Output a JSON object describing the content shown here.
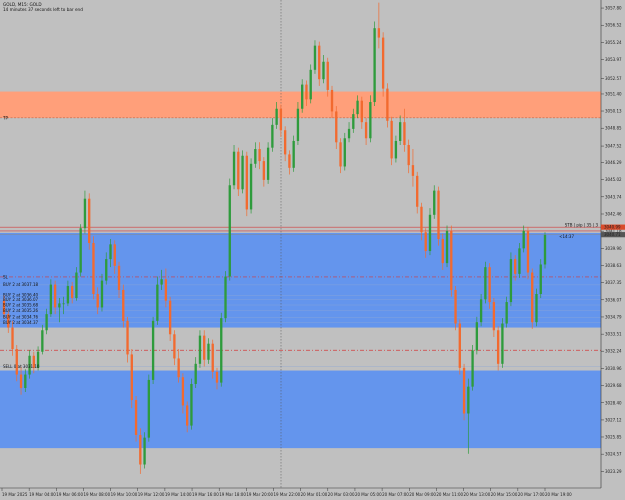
{
  "window": {
    "symbol_line": "GOLD, M15: GOLD",
    "countdown_line": "14 minutes 37 seconds left to bar end"
  },
  "colors": {
    "background": "#c0c0c0",
    "bull_candle": "#2e9b3c",
    "bear_candle": "#f26a2f",
    "blue_zone": "#6495ed",
    "salmon_zone": "#ff9f7a",
    "red_dash": "#d23a3a",
    "price_tag": "#d94b2b"
  },
  "zones": [
    {
      "name": "salmon",
      "from": 3051.58,
      "to": 3049.62
    },
    {
      "name": "blue-upper",
      "from": 3041.05,
      "to": 3034.0
    },
    {
      "name": "blue-lower",
      "from": 3030.8,
      "to": 3025.02
    }
  ],
  "levels": {
    "tp": {
      "label": "TP",
      "price": 3049.62
    },
    "red_line_1": 3041.48,
    "red_line_2": 3041.2,
    "dash_1": 3037.77,
    "dash_2": 3032.31,
    "current_price": 3040.92,
    "stop_tag": "3040.99",
    "bid_tag": "3040.71"
  },
  "order_labels": [
    "BUY 2 at 3037.18",
    "BUY 2 at 3036.40",
    "BUY 2 at 3036.07",
    "BUY 2 at 3035.68",
    "BUY 2 at 3035.26",
    "BUY 2 at 3034.76",
    "BUY 2 at 3034.37"
  ],
  "sl_label": "SL",
  "sell_label": "SELL 0 at 3031.10",
  "stop_line_label": "STB | pip | 35 | 3",
  "countdown_tag": "<14:37",
  "price_axis": [
    "3057.80",
    "3056.52",
    "3055.24",
    "3053.97",
    "3052.57",
    "3051.40",
    "3050.13",
    "3048.85",
    "3047.52",
    "3046.29",
    "3045.02",
    "3043.74",
    "3042.46",
    "3041.18",
    "3039.90",
    "3038.63",
    "3037.35",
    "3036.07",
    "3034.79",
    "3033.51",
    "3032.24",
    "3030.96",
    "3029.68",
    "3028.40",
    "3027.12",
    "3025.85",
    "3024.57",
    "3023.29"
  ],
  "time_axis": [
    "19 Mar 2025",
    "19 Mar 04:00",
    "19 Mar 06:00",
    "19 Mar 08:00",
    "19 Mar 10:00",
    "19 Mar 12:00",
    "19 Mar 14:00",
    "19 Mar 16:00",
    "19 Mar 18:00",
    "19 Mar 20:00",
    "19 Mar 22:00",
    "20 Mar 01:00",
    "20 Mar 03:00",
    "20 Mar 05:00",
    "20 Mar 07:00",
    "20 Mar 09:00",
    "20 Mar 11:00",
    "20 Mar 13:00",
    "20 Mar 15:00",
    "20 Mar 17:00",
    "20 Mar 19:00"
  ],
  "price_range": [
    3022.05,
    3058.4
  ],
  "chart_data": {
    "type": "candlestick",
    "timeframe": "M15",
    "ohlc": [
      [
        3036.0,
        3036.4,
        3034.7,
        3035.0
      ],
      [
        3035.0,
        3035.3,
        3033.6,
        3034.0
      ],
      [
        3034.0,
        3034.5,
        3031.9,
        3032.4
      ],
      [
        3032.4,
        3032.7,
        3030.0,
        3030.5
      ],
      [
        3030.5,
        3031.1,
        3029.0,
        3029.5
      ],
      [
        3029.5,
        3030.9,
        3029.2,
        3030.5
      ],
      [
        3030.5,
        3032.3,
        3030.2,
        3031.9
      ],
      [
        3031.9,
        3032.2,
        3030.6,
        3031.0
      ],
      [
        3031.0,
        3032.6,
        3030.8,
        3032.2
      ],
      [
        3032.2,
        3034.2,
        3032.0,
        3033.8
      ],
      [
        3033.8,
        3035.4,
        3033.5,
        3035.0
      ],
      [
        3035.0,
        3037.6,
        3034.8,
        3037.2
      ],
      [
        3037.2,
        3037.5,
        3035.0,
        3035.5
      ],
      [
        3035.5,
        3036.2,
        3034.4,
        3035.8
      ],
      [
        3035.8,
        3036.3,
        3035.0,
        3035.8
      ],
      [
        3035.8,
        3037.5,
        3035.6,
        3037.1
      ],
      [
        3037.1,
        3037.4,
        3035.8,
        3036.2
      ],
      [
        3036.2,
        3038.5,
        3036.0,
        3038.1
      ],
      [
        3038.1,
        3041.7,
        3037.8,
        3041.4
      ],
      [
        3041.4,
        3044.2,
        3041.0,
        3043.6
      ],
      [
        3043.6,
        3044.0,
        3039.8,
        3040.3
      ],
      [
        3040.3,
        3040.8,
        3036.1,
        3036.5
      ],
      [
        3036.5,
        3037.0,
        3035.0,
        3035.5
      ],
      [
        3035.5,
        3038.0,
        3035.2,
        3037.5
      ],
      [
        3037.5,
        3039.6,
        3037.2,
        3039.1
      ],
      [
        3039.1,
        3040.6,
        3038.5,
        3040.2
      ],
      [
        3040.2,
        3040.5,
        3038.0,
        3038.6
      ],
      [
        3038.6,
        3038.9,
        3036.2,
        3036.8
      ],
      [
        3036.8,
        3037.2,
        3034.0,
        3034.5
      ],
      [
        3034.5,
        3034.8,
        3031.4,
        3032.0
      ],
      [
        3032.0,
        3032.4,
        3028.0,
        3028.6
      ],
      [
        3028.6,
        3028.9,
        3025.5,
        3026.0
      ],
      [
        3026.0,
        3026.5,
        3023.1,
        3023.8
      ],
      [
        3023.8,
        3026.2,
        3023.5,
        3025.8
      ],
      [
        3025.8,
        3030.5,
        3025.5,
        3030.1
      ],
      [
        3030.1,
        3034.8,
        3029.8,
        3034.5
      ],
      [
        3034.5,
        3037.8,
        3034.2,
        3037.2
      ],
      [
        3037.2,
        3038.3,
        3036.8,
        3037.6
      ],
      [
        3037.6,
        3038.4,
        3035.5,
        3036.0
      ],
      [
        3036.0,
        3036.3,
        3033.0,
        3033.5
      ],
      [
        3033.5,
        3033.8,
        3031.2,
        3031.7
      ],
      [
        3031.7,
        3032.4,
        3029.9,
        3030.3
      ],
      [
        3030.3,
        3030.6,
        3027.6,
        3028.2
      ],
      [
        3028.2,
        3028.5,
        3026.2,
        3026.7
      ],
      [
        3026.7,
        3030.2,
        3026.4,
        3029.8
      ],
      [
        3029.8,
        3031.8,
        3029.5,
        3031.3
      ],
      [
        3031.3,
        3033.8,
        3031.0,
        3033.4
      ],
      [
        3033.4,
        3033.8,
        3031.1,
        3031.6
      ],
      [
        3031.6,
        3033.2,
        3031.3,
        3032.8
      ],
      [
        3032.8,
        3033.1,
        3030.2,
        3030.7
      ],
      [
        3030.7,
        3031.0,
        3029.4,
        3029.9
      ],
      [
        3029.9,
        3035.1,
        3029.6,
        3034.7
      ],
      [
        3034.7,
        3038.2,
        3034.4,
        3037.8
      ],
      [
        3037.8,
        3045.1,
        3037.5,
        3044.6
      ],
      [
        3044.6,
        3047.6,
        3044.3,
        3047.1
      ],
      [
        3047.1,
        3047.4,
        3043.8,
        3044.3
      ],
      [
        3044.3,
        3047.2,
        3044.0,
        3046.8
      ],
      [
        3046.8,
        3047.1,
        3042.3,
        3042.8
      ],
      [
        3042.8,
        3046.6,
        3042.5,
        3046.2
      ],
      [
        3046.2,
        3047.8,
        3045.9,
        3047.3
      ],
      [
        3047.3,
        3047.8,
        3045.8,
        3046.4
      ],
      [
        3046.4,
        3046.7,
        3044.5,
        3045.0
      ],
      [
        3045.0,
        3047.8,
        3044.7,
        3047.4
      ],
      [
        3047.4,
        3049.6,
        3047.1,
        3049.1
      ],
      [
        3049.1,
        3050.8,
        3048.8,
        3050.3
      ],
      [
        3050.3,
        3050.6,
        3048.2,
        3048.7
      ],
      [
        3048.7,
        3049.0,
        3046.4,
        3046.9
      ],
      [
        3046.9,
        3047.2,
        3045.4,
        3045.9
      ],
      [
        3045.9,
        3048.3,
        3045.6,
        3047.9
      ],
      [
        3047.9,
        3050.8,
        3047.6,
        3050.3
      ],
      [
        3050.3,
        3052.5,
        3050.0,
        3052.1
      ],
      [
        3052.1,
        3052.4,
        3050.5,
        3051.0
      ],
      [
        3051.0,
        3053.6,
        3050.7,
        3053.2
      ],
      [
        3053.2,
        3055.4,
        3052.9,
        3055.0
      ],
      [
        3055.0,
        3055.3,
        3052.0,
        3052.5
      ],
      [
        3052.5,
        3054.3,
        3052.2,
        3053.8
      ],
      [
        3053.8,
        3054.1,
        3051.2,
        3051.7
      ],
      [
        3051.7,
        3052.0,
        3049.6,
        3050.1
      ],
      [
        3050.1,
        3050.5,
        3047.3,
        3047.8
      ],
      [
        3047.8,
        3048.1,
        3045.5,
        3046.0
      ],
      [
        3046.0,
        3048.5,
        3045.7,
        3048.1
      ],
      [
        3048.1,
        3049.3,
        3047.8,
        3048.8
      ],
      [
        3048.8,
        3050.3,
        3048.5,
        3049.9
      ],
      [
        3049.9,
        3051.3,
        3049.6,
        3050.9
      ],
      [
        3050.9,
        3051.2,
        3048.8,
        3049.3
      ],
      [
        3049.3,
        3049.6,
        3047.6,
        3048.1
      ],
      [
        3048.1,
        3051.3,
        3047.8,
        3050.8
      ],
      [
        3050.8,
        3056.8,
        3050.5,
        3056.3
      ],
      [
        3056.3,
        3058.2,
        3054.8,
        3055.6
      ],
      [
        3055.6,
        3056.0,
        3051.2,
        3051.8
      ],
      [
        3051.8,
        3052.2,
        3048.9,
        3049.4
      ],
      [
        3049.4,
        3049.7,
        3046.1,
        3046.6
      ],
      [
        3046.6,
        3048.3,
        3046.3,
        3047.9
      ],
      [
        3047.9,
        3049.8,
        3047.6,
        3049.3
      ],
      [
        3049.3,
        3050.3,
        3047.1,
        3047.6
      ],
      [
        3047.6,
        3048.0,
        3045.5,
        3046.1
      ],
      [
        3046.1,
        3047.3,
        3044.5,
        3045.3
      ],
      [
        3045.3,
        3045.6,
        3042.5,
        3043.0
      ],
      [
        3043.0,
        3043.3,
        3040.5,
        3041.1
      ],
      [
        3041.1,
        3041.4,
        3039.2,
        3039.7
      ],
      [
        3039.7,
        3042.9,
        3039.4,
        3042.4
      ],
      [
        3042.4,
        3044.6,
        3042.1,
        3044.2
      ],
      [
        3044.2,
        3044.5,
        3040.1,
        3040.6
      ],
      [
        3040.6,
        3041.0,
        3038.3,
        3038.8
      ],
      [
        3038.8,
        3041.6,
        3038.5,
        3041.2
      ],
      [
        3041.2,
        3041.6,
        3036.3,
        3036.8
      ],
      [
        3036.8,
        3037.1,
        3033.8,
        3034.3
      ],
      [
        3034.3,
        3034.6,
        3030.5,
        3031.0
      ],
      [
        3031.0,
        3031.3,
        3027.1,
        3027.6
      ],
      [
        3027.6,
        3030.2,
        3024.6,
        3029.6
      ],
      [
        3029.6,
        3032.7,
        3029.3,
        3032.3
      ],
      [
        3032.3,
        3034.8,
        3032.0,
        3034.4
      ],
      [
        3034.4,
        3036.5,
        3034.1,
        3036.1
      ],
      [
        3036.1,
        3038.9,
        3035.8,
        3038.5
      ],
      [
        3038.5,
        3038.8,
        3035.4,
        3035.9
      ],
      [
        3035.9,
        3036.2,
        3033.3,
        3033.8
      ],
      [
        3033.8,
        3034.1,
        3030.8,
        3031.3
      ],
      [
        3031.3,
        3034.7,
        3031.0,
        3034.3
      ],
      [
        3034.3,
        3036.3,
        3034.0,
        3035.9
      ],
      [
        3035.9,
        3039.6,
        3035.6,
        3039.1
      ],
      [
        3039.1,
        3039.4,
        3037.5,
        3038.0
      ],
      [
        3038.0,
        3040.3,
        3037.7,
        3039.9
      ],
      [
        3039.9,
        3041.6,
        3039.6,
        3041.2
      ],
      [
        3041.2,
        3041.5,
        3037.6,
        3038.1
      ],
      [
        3038.1,
        3038.4,
        3033.9,
        3034.4
      ],
      [
        3034.4,
        3036.9,
        3034.1,
        3036.5
      ],
      [
        3036.5,
        3039.1,
        3036.2,
        3038.7
      ],
      [
        3038.7,
        3041.1,
        3038.4,
        3040.9
      ]
    ]
  }
}
